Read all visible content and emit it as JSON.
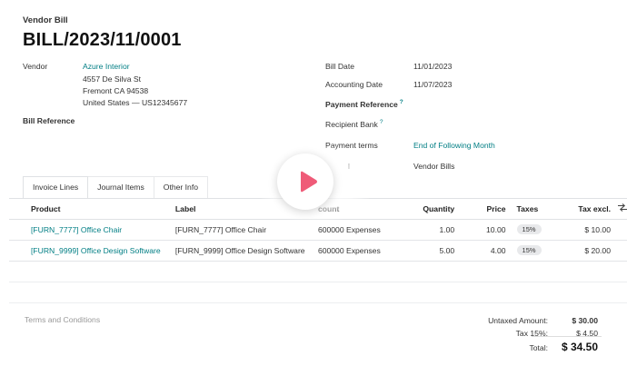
{
  "header": {
    "doc_type": "Vendor Bill",
    "bill_number": "BILL/2023/11/0001"
  },
  "left_fields": {
    "vendor_label": "Vendor",
    "vendor_name": "Azure Interior",
    "vendor_address": [
      "4557 De Silva St",
      "Fremont CA 94538",
      "United States — US12345677"
    ],
    "bill_reference_label": "Bill Reference"
  },
  "right_fields": {
    "bill_date_label": "Bill Date",
    "bill_date": "11/01/2023",
    "accounting_date_label": "Accounting Date",
    "accounting_date": "11/07/2023",
    "payment_reference_label": "Payment Reference",
    "recipient_bank_label": "Recipient Bank",
    "payment_terms_label": "Payment terms",
    "payment_terms": "End of Following Month",
    "journal_label": "l",
    "journal": "Vendor Bills",
    "help_mark": "?"
  },
  "tabs": [
    "Invoice Lines",
    "Journal Items",
    "Other Info"
  ],
  "table": {
    "headers": {
      "product": "Product",
      "label": "Label",
      "account": "count",
      "quantity": "Quantity",
      "price": "Price",
      "taxes": "Taxes",
      "tax_excl": "Tax excl."
    },
    "rows": [
      {
        "product": "[FURN_7777] Office Chair",
        "label": "[FURN_7777] Office Chair",
        "account": "600000 Expenses",
        "quantity": "1.00",
        "price": "10.00",
        "taxes": "15%",
        "tax_excl": "$ 10.00"
      },
      {
        "product": "[FURN_9999] Office Design Software",
        "label": "[FURN_9999] Office Design Software",
        "account": "600000 Expenses",
        "quantity": "5.00",
        "price": "4.00",
        "taxes": "15%",
        "tax_excl": "$ 20.00"
      }
    ]
  },
  "footer": {
    "terms_placeholder": "Terms and Conditions",
    "untaxed_label": "Untaxed Amount:",
    "untaxed_value": "$ 30.00",
    "tax_label": "Tax 15%:",
    "tax_value": "$ 4.50",
    "total_label": "Total:",
    "total_value": "$ 34.50"
  },
  "colors": {
    "link": "#017e84",
    "play": "#ef5b78"
  }
}
